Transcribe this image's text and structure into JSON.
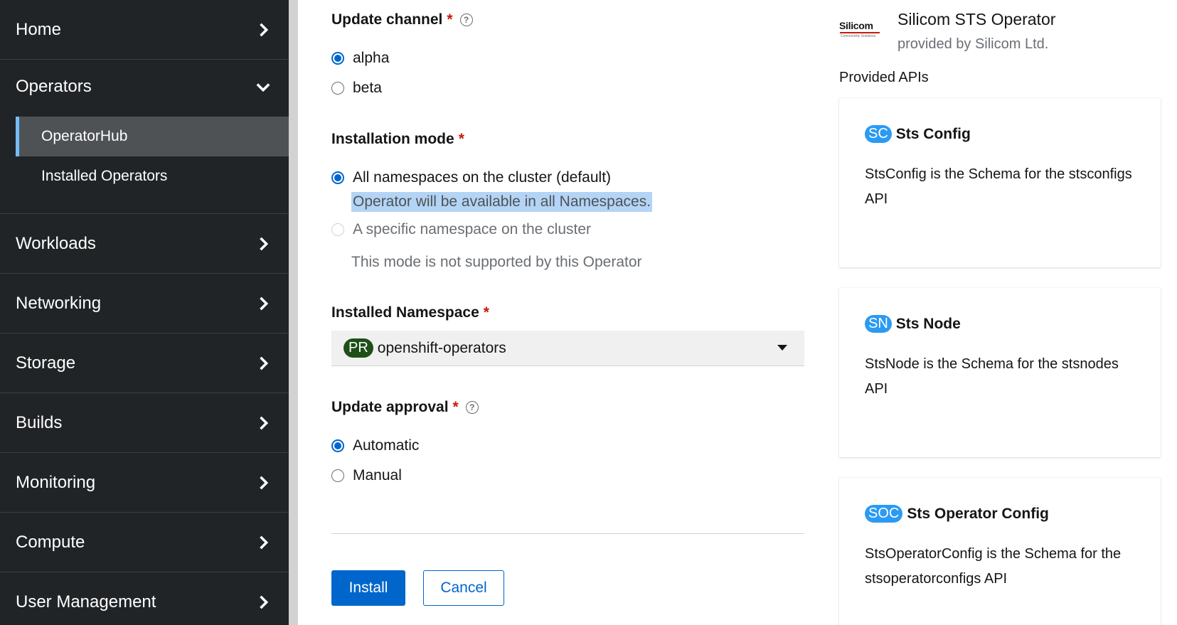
{
  "sidebar": {
    "groups": [
      {
        "label": "Home"
      },
      {
        "label": "Operators"
      },
      {
        "label": "Workloads"
      },
      {
        "label": "Networking"
      },
      {
        "label": "Storage"
      },
      {
        "label": "Builds"
      },
      {
        "label": "Monitoring"
      },
      {
        "label": "Compute"
      },
      {
        "label": "User Management"
      }
    ],
    "operators_items": [
      {
        "label": "OperatorHub",
        "active": true
      },
      {
        "label": "Installed Operators",
        "active": false
      }
    ]
  },
  "form": {
    "update_channel": {
      "label": "Update channel",
      "required_mark": "*",
      "help_icon": "help-circle-icon",
      "options": [
        {
          "label": "alpha",
          "checked": true
        },
        {
          "label": "beta",
          "checked": false
        }
      ]
    },
    "installation_mode": {
      "label": "Installation mode",
      "required_mark": "*",
      "options": [
        {
          "label": "All namespaces on the cluster (default)",
          "checked": true,
          "description": "Operator will be available in all Namespaces."
        },
        {
          "label": "A specific namespace on the cluster",
          "checked": false,
          "disabled": true,
          "description": "This mode is not supported by this Operator"
        }
      ]
    },
    "installed_namespace": {
      "label": "Installed Namespace",
      "required_mark": "*",
      "badge": "PR",
      "value": "openshift-operators"
    },
    "update_approval": {
      "label": "Update approval",
      "required_mark": "*",
      "help_icon": "help-circle-icon",
      "options": [
        {
          "label": "Automatic",
          "checked": true
        },
        {
          "label": "Manual",
          "checked": false
        }
      ]
    },
    "buttons": {
      "install": "Install",
      "cancel": "Cancel"
    }
  },
  "operator": {
    "logo_text": "Silicom",
    "logo_tagline": "Connectivity Solutions",
    "name": "Silicom STS Operator",
    "provider": "provided by Silicom Ltd.",
    "apis_title": "Provided APIs",
    "apis": [
      {
        "badge": "SC",
        "name": "Sts Config",
        "description": "StsConfig is the Schema for the stsconfigs API"
      },
      {
        "badge": "SN",
        "name": "Sts Node",
        "description": "StsNode is the Schema for the stsnodes API"
      },
      {
        "badge": "SOC",
        "name": "Sts Operator Config",
        "description": "StsOperatorConfig is the Schema for the stsoperatorconfigs API"
      }
    ]
  },
  "colors": {
    "sidebar_bg": "#212427",
    "active_item_bg": "#4f5255",
    "active_indicator": "#73bcf7",
    "primary": "#0066cc",
    "required": "#c9190b",
    "api_badge": "#2b9af3",
    "namespace_badge": "#1e4f18"
  }
}
